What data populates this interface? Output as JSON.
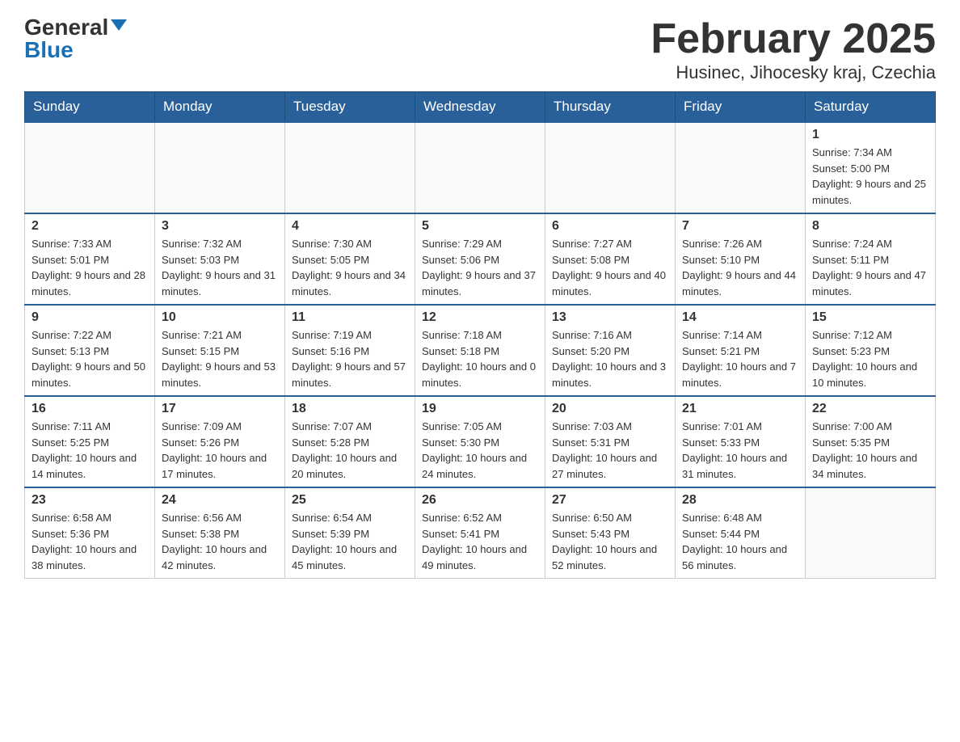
{
  "header": {
    "logo_general": "General",
    "logo_blue": "Blue",
    "title": "February 2025",
    "subtitle": "Husinec, Jihocesky kraj, Czechia"
  },
  "days_of_week": [
    "Sunday",
    "Monday",
    "Tuesday",
    "Wednesday",
    "Thursday",
    "Friday",
    "Saturday"
  ],
  "weeks": [
    [
      {
        "day": "",
        "info": ""
      },
      {
        "day": "",
        "info": ""
      },
      {
        "day": "",
        "info": ""
      },
      {
        "day": "",
        "info": ""
      },
      {
        "day": "",
        "info": ""
      },
      {
        "day": "",
        "info": ""
      },
      {
        "day": "1",
        "info": "Sunrise: 7:34 AM\nSunset: 5:00 PM\nDaylight: 9 hours and 25 minutes."
      }
    ],
    [
      {
        "day": "2",
        "info": "Sunrise: 7:33 AM\nSunset: 5:01 PM\nDaylight: 9 hours and 28 minutes."
      },
      {
        "day": "3",
        "info": "Sunrise: 7:32 AM\nSunset: 5:03 PM\nDaylight: 9 hours and 31 minutes."
      },
      {
        "day": "4",
        "info": "Sunrise: 7:30 AM\nSunset: 5:05 PM\nDaylight: 9 hours and 34 minutes."
      },
      {
        "day": "5",
        "info": "Sunrise: 7:29 AM\nSunset: 5:06 PM\nDaylight: 9 hours and 37 minutes."
      },
      {
        "day": "6",
        "info": "Sunrise: 7:27 AM\nSunset: 5:08 PM\nDaylight: 9 hours and 40 minutes."
      },
      {
        "day": "7",
        "info": "Sunrise: 7:26 AM\nSunset: 5:10 PM\nDaylight: 9 hours and 44 minutes."
      },
      {
        "day": "8",
        "info": "Sunrise: 7:24 AM\nSunset: 5:11 PM\nDaylight: 9 hours and 47 minutes."
      }
    ],
    [
      {
        "day": "9",
        "info": "Sunrise: 7:22 AM\nSunset: 5:13 PM\nDaylight: 9 hours and 50 minutes."
      },
      {
        "day": "10",
        "info": "Sunrise: 7:21 AM\nSunset: 5:15 PM\nDaylight: 9 hours and 53 minutes."
      },
      {
        "day": "11",
        "info": "Sunrise: 7:19 AM\nSunset: 5:16 PM\nDaylight: 9 hours and 57 minutes."
      },
      {
        "day": "12",
        "info": "Sunrise: 7:18 AM\nSunset: 5:18 PM\nDaylight: 10 hours and 0 minutes."
      },
      {
        "day": "13",
        "info": "Sunrise: 7:16 AM\nSunset: 5:20 PM\nDaylight: 10 hours and 3 minutes."
      },
      {
        "day": "14",
        "info": "Sunrise: 7:14 AM\nSunset: 5:21 PM\nDaylight: 10 hours and 7 minutes."
      },
      {
        "day": "15",
        "info": "Sunrise: 7:12 AM\nSunset: 5:23 PM\nDaylight: 10 hours and 10 minutes."
      }
    ],
    [
      {
        "day": "16",
        "info": "Sunrise: 7:11 AM\nSunset: 5:25 PM\nDaylight: 10 hours and 14 minutes."
      },
      {
        "day": "17",
        "info": "Sunrise: 7:09 AM\nSunset: 5:26 PM\nDaylight: 10 hours and 17 minutes."
      },
      {
        "day": "18",
        "info": "Sunrise: 7:07 AM\nSunset: 5:28 PM\nDaylight: 10 hours and 20 minutes."
      },
      {
        "day": "19",
        "info": "Sunrise: 7:05 AM\nSunset: 5:30 PM\nDaylight: 10 hours and 24 minutes."
      },
      {
        "day": "20",
        "info": "Sunrise: 7:03 AM\nSunset: 5:31 PM\nDaylight: 10 hours and 27 minutes."
      },
      {
        "day": "21",
        "info": "Sunrise: 7:01 AM\nSunset: 5:33 PM\nDaylight: 10 hours and 31 minutes."
      },
      {
        "day": "22",
        "info": "Sunrise: 7:00 AM\nSunset: 5:35 PM\nDaylight: 10 hours and 34 minutes."
      }
    ],
    [
      {
        "day": "23",
        "info": "Sunrise: 6:58 AM\nSunset: 5:36 PM\nDaylight: 10 hours and 38 minutes."
      },
      {
        "day": "24",
        "info": "Sunrise: 6:56 AM\nSunset: 5:38 PM\nDaylight: 10 hours and 42 minutes."
      },
      {
        "day": "25",
        "info": "Sunrise: 6:54 AM\nSunset: 5:39 PM\nDaylight: 10 hours and 45 minutes."
      },
      {
        "day": "26",
        "info": "Sunrise: 6:52 AM\nSunset: 5:41 PM\nDaylight: 10 hours and 49 minutes."
      },
      {
        "day": "27",
        "info": "Sunrise: 6:50 AM\nSunset: 5:43 PM\nDaylight: 10 hours and 52 minutes."
      },
      {
        "day": "28",
        "info": "Sunrise: 6:48 AM\nSunset: 5:44 PM\nDaylight: 10 hours and 56 minutes."
      },
      {
        "day": "",
        "info": ""
      }
    ]
  ]
}
